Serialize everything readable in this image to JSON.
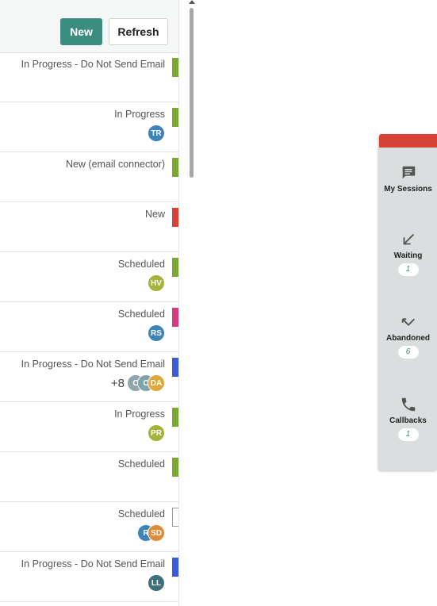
{
  "toolbar": {
    "new_label": "New",
    "refresh_label": "Refresh"
  },
  "rows": [
    {
      "status": "In Progress - Do Not Send Email",
      "bar_color": "#7ba832",
      "avatars": []
    },
    {
      "status": "In Progress",
      "bar_color": "#7ba832",
      "avatars": [
        {
          "initials": "TR",
          "color": "#3d84b8"
        }
      ]
    },
    {
      "status": "New (email connector)",
      "bar_color": "#7ba832",
      "avatars": []
    },
    {
      "status": "New",
      "bar_color": "#d64234",
      "avatars": []
    },
    {
      "status": "Scheduled",
      "bar_color": "#7ba832",
      "avatars": [
        {
          "initials": "HV",
          "color": "#a4b33a"
        }
      ]
    },
    {
      "status": "Scheduled",
      "bar_color": "#d63b86",
      "avatars": [
        {
          "initials": "RS",
          "color": "#3d84b8"
        }
      ]
    },
    {
      "status": "In Progress - Do Not Send Email",
      "bar_color": "#3b5bd9",
      "more": "+8",
      "avatars": [
        {
          "initials": "C",
          "color": "#8fa6ae"
        },
        {
          "initials": "C",
          "color": "#7fa3ab"
        },
        {
          "initials": "DA",
          "color": "#e0a73a"
        }
      ]
    },
    {
      "status": "In Progress",
      "bar_color": "#7ba832",
      "avatars": [
        {
          "initials": "PR",
          "color": "#a4b33a"
        }
      ]
    },
    {
      "status": "Scheduled",
      "bar_color": "#7ba832",
      "avatars": []
    },
    {
      "status": "Scheduled",
      "bar_color": "",
      "avatars": [
        {
          "initials": "R",
          "color": "#3d84b8"
        },
        {
          "initials": "SD",
          "color": "#e08a3a"
        }
      ]
    },
    {
      "status": "In Progress - Do Not Send Email",
      "bar_color": "#3b5bd9",
      "avatars": [
        {
          "initials": "LL",
          "color": "#3d6f7d"
        }
      ]
    }
  ],
  "sidebar": {
    "accent": "#d64234",
    "items": [
      {
        "label": "My Sessions",
        "icon": "chat-icon",
        "badge": ""
      },
      {
        "label": "Waiting",
        "icon": "arrow-down-left-icon",
        "badge": "1"
      },
      {
        "label": "Abandoned",
        "icon": "missed-call-icon",
        "badge": "6"
      },
      {
        "label": "Callbacks",
        "icon": "phone-icon",
        "badge": "1"
      }
    ]
  }
}
